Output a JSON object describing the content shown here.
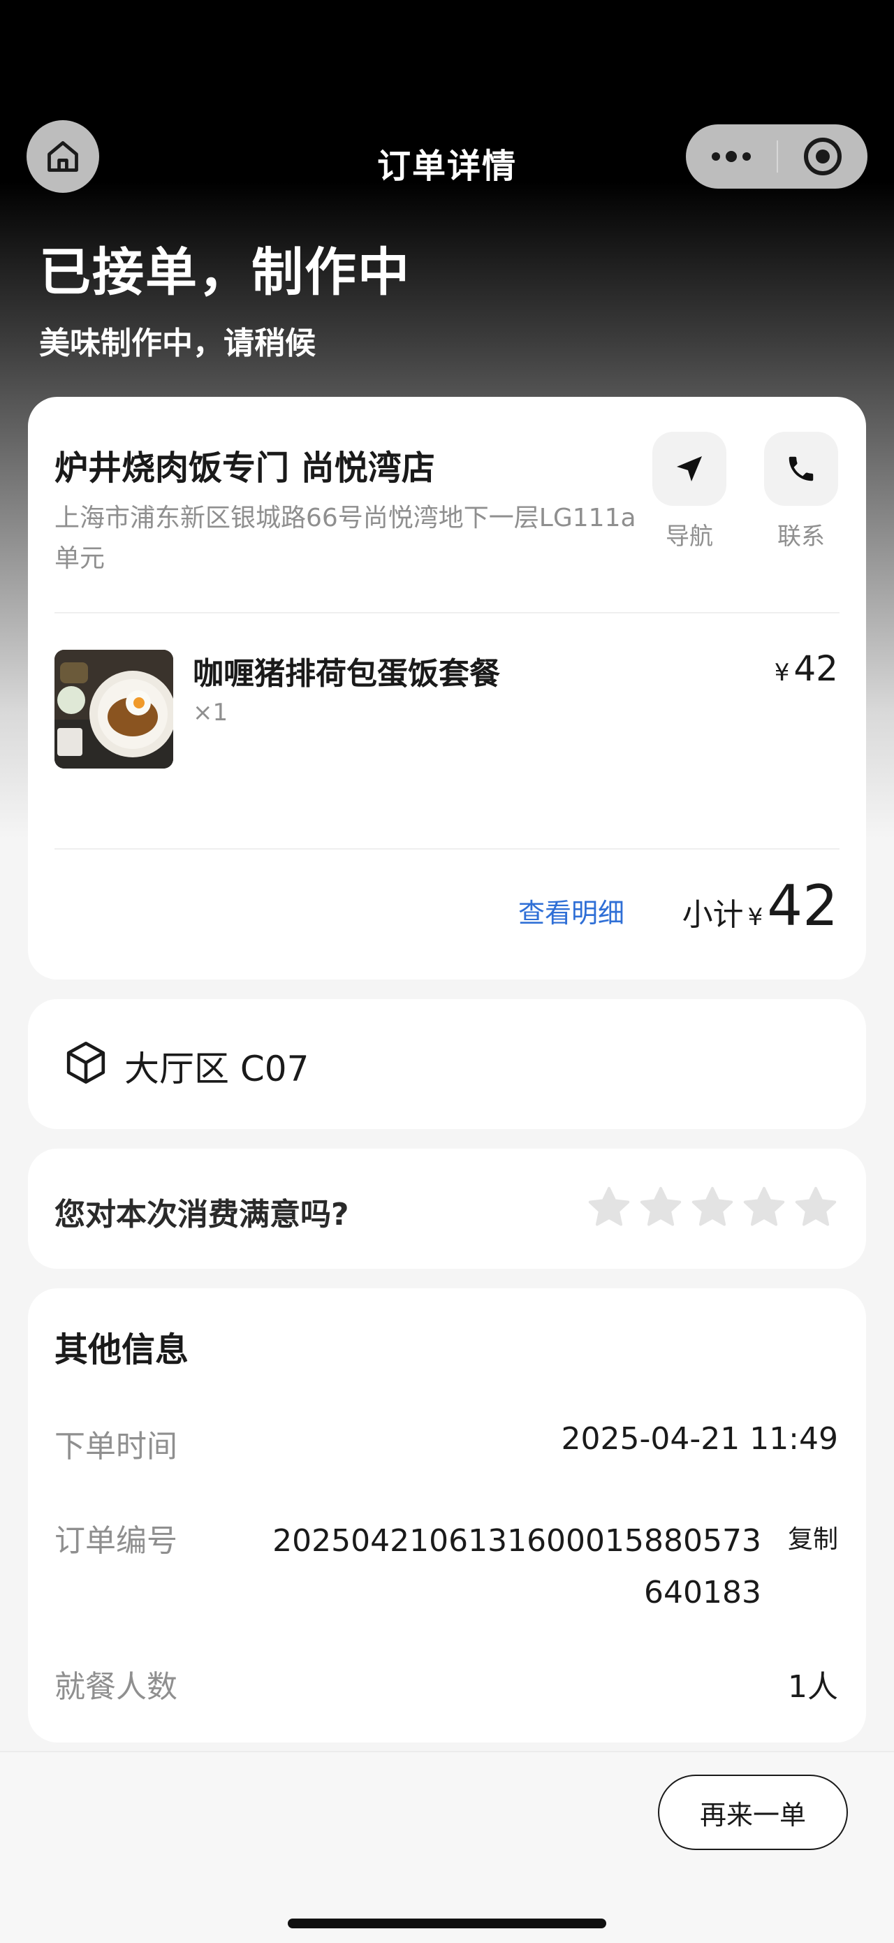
{
  "nav": {
    "title": "订单详情"
  },
  "status": {
    "title": "已接单，制作中",
    "subtitle": "美味制作中，请稍候"
  },
  "store": {
    "name": "炉井烧肉饭专门 尚悦湾店",
    "address": "上海市浦东新区银城路66号尚悦湾地下一层LG111a单元",
    "actions": {
      "navigate": "导航",
      "contact": "联系"
    }
  },
  "item": {
    "name": "咖喱猪排荷包蛋饭套餐",
    "qty": "×1",
    "currency": "¥",
    "price": "42"
  },
  "summary": {
    "detail_link": "查看明细",
    "subtotal_label": "小计",
    "currency": "¥",
    "subtotal": "42"
  },
  "table": {
    "text": "大厅区 C07"
  },
  "rating": {
    "question": "您对本次消费满意吗?",
    "stars_total": 5,
    "stars_selected": 0
  },
  "info": {
    "title": "其他信息",
    "order_time_label": "下单时间",
    "order_time": "2025-04-21 11:49",
    "order_no_label": "订单编号",
    "order_no": "2025042106131600015880573640183",
    "copy": "复制",
    "diners_label": "就餐人数",
    "diners": "1人"
  },
  "footer": {
    "reorder": "再来一单"
  },
  "colors": {
    "link": "#2f6fd6",
    "star_empty": "#e3e3e3"
  }
}
